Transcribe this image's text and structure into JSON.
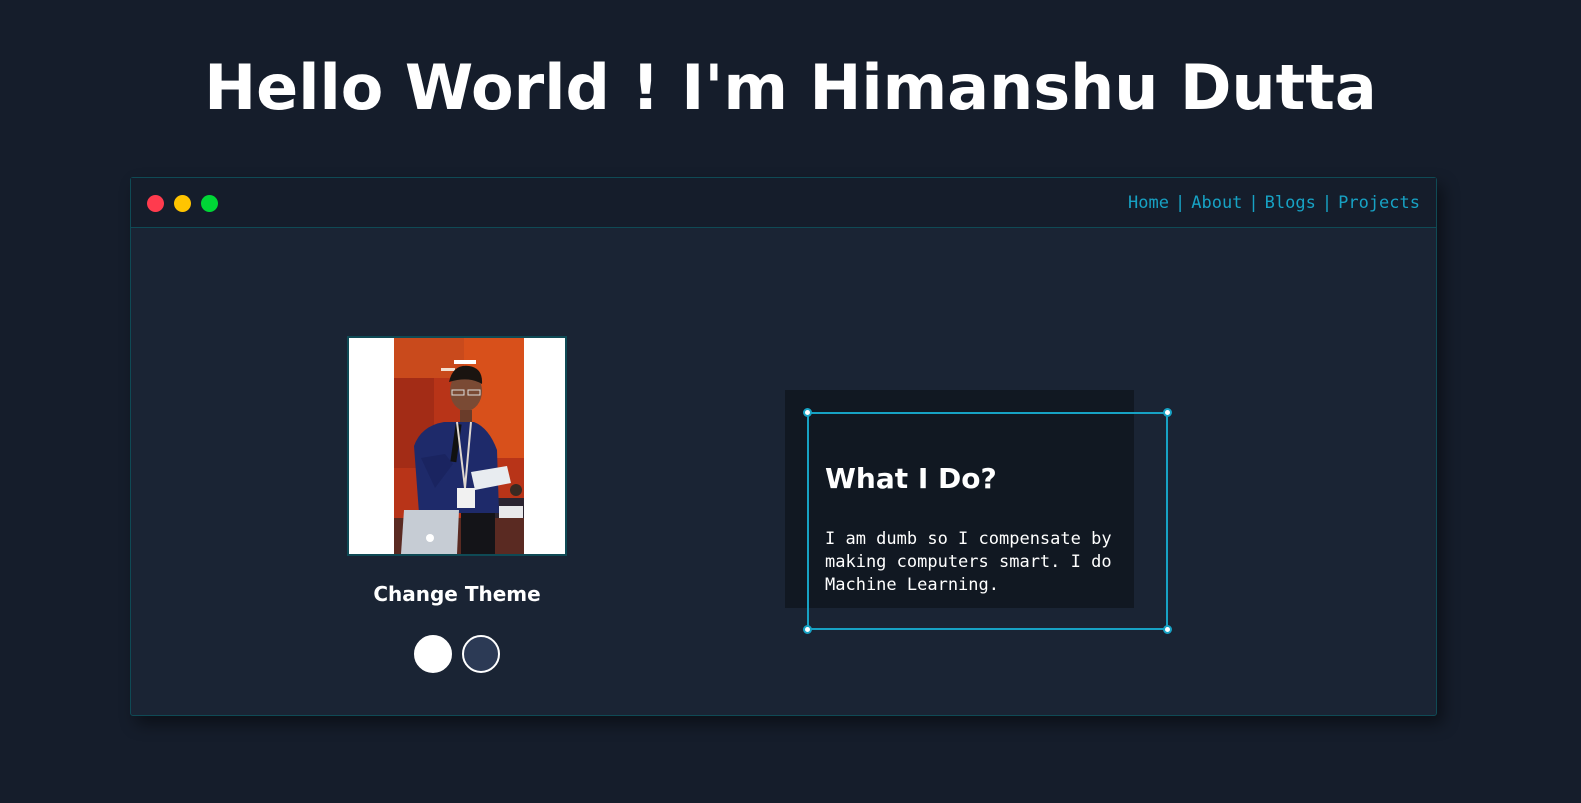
{
  "header": {
    "title": "Hello World ! I'm Himanshu Dutta"
  },
  "window": {
    "controls": [
      {
        "name": "close",
        "color": "#ff3b4e"
      },
      {
        "name": "minimize",
        "color": "#ffc400"
      },
      {
        "name": "maximize",
        "color": "#00d636"
      }
    ],
    "nav": {
      "separator": "|",
      "items": [
        {
          "label": "Home"
        },
        {
          "label": "About"
        },
        {
          "label": "Blogs"
        },
        {
          "label": "Projects"
        }
      ]
    }
  },
  "profile": {
    "photo_icon": "profile-photo",
    "theme_label": "Change Theme",
    "themes": [
      {
        "name": "light",
        "color": "#ffffff"
      },
      {
        "name": "dark",
        "color": "#2c3a55"
      }
    ]
  },
  "card": {
    "title": "What I Do?",
    "text": "I am dumb so I compensate by making computers smart. I do Machine Learning."
  },
  "colors": {
    "background": "#151d2b",
    "window_body": "#1a2434",
    "accent": "#17a2c4",
    "border": "#0f4a55"
  }
}
